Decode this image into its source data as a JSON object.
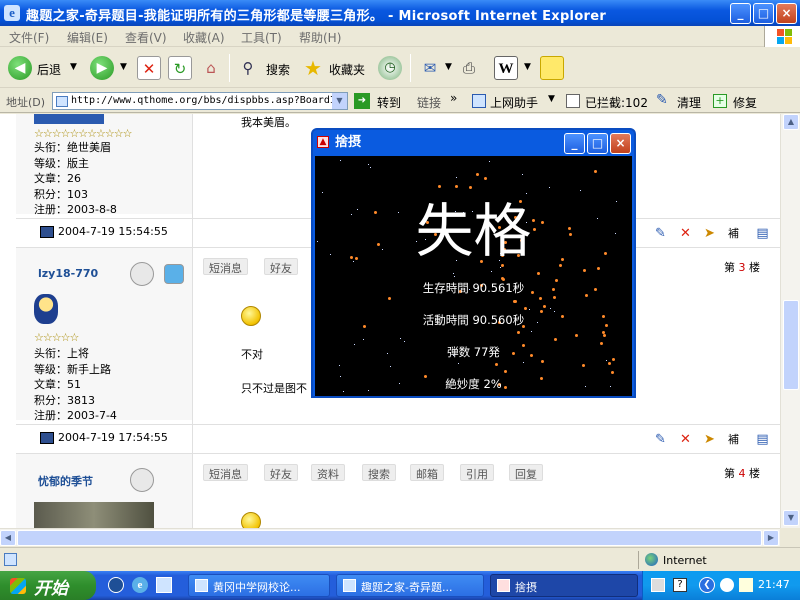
{
  "window": {
    "title": "趣题之家-奇异题目-我能证明所有的三角形都是等腰三角形。 - Microsoft Internet Explorer",
    "controls": [
      "_",
      "□",
      "×"
    ]
  },
  "menu": [
    "文件(F)",
    "编辑(E)",
    "查看(V)",
    "收藏(A)",
    "工具(T)",
    "帮助(H)"
  ],
  "toolbar": {
    "back": "后退",
    "search": "搜索",
    "favorites": "收藏夹"
  },
  "address": {
    "label": "地址(D)",
    "url": "http://www.qthome.org/bbs/dispbbs.asp?BoardID",
    "go": "转到",
    "links": "链接",
    "extras": [
      "上网助手",
      "已拦截:102",
      "清理",
      "修复"
    ]
  },
  "thread": {
    "top_text": "我本美眉。",
    "posts": [
      {
        "stars": "☆☆☆☆☆☆☆☆☆☆☆",
        "info": [
          "头衔：绝世美眉",
          "等级：版主",
          "文章：26",
          "积分：103",
          "注册：2003-8-8"
        ],
        "date": "2004-7-19 15:54:55"
      },
      {
        "username": "lzy18-770",
        "stars": "☆☆☆☆☆",
        "info": [
          "头衔：上将",
          "等级：新手上路",
          "文章：51",
          "积分：3813",
          "注册：2003-7-4"
        ],
        "buttons": [
          "短消息",
          "好友"
        ],
        "floor_prefix": "第",
        "floor_num": "3",
        "floor_suffix": "楼",
        "body": [
          "不对",
          "只不过是图不"
        ],
        "date": "2004-7-19 17:54:55"
      },
      {
        "username": "忧郁的季节",
        "buttons": [
          "短消息",
          "好友",
          "资料",
          "搜索",
          "邮箱",
          "引用",
          "回复"
        ],
        "floor_prefix": "第",
        "floor_num": "4",
        "floor_suffix": "楼"
      }
    ],
    "action_label": "補"
  },
  "popup": {
    "title": "捨摂",
    "headline": "失格",
    "stats": [
      "生存時間 90.561秒",
      "活動時間 90.560秒",
      "弾数 77発",
      "絶妙度 2%"
    ]
  },
  "status": {
    "zone": "Internet"
  },
  "taskbar": {
    "start": "开始",
    "tasks": [
      "黄冈中学网校论...",
      "趣题之家-奇异题...",
      "捨摂"
    ],
    "clock": "21:47"
  }
}
